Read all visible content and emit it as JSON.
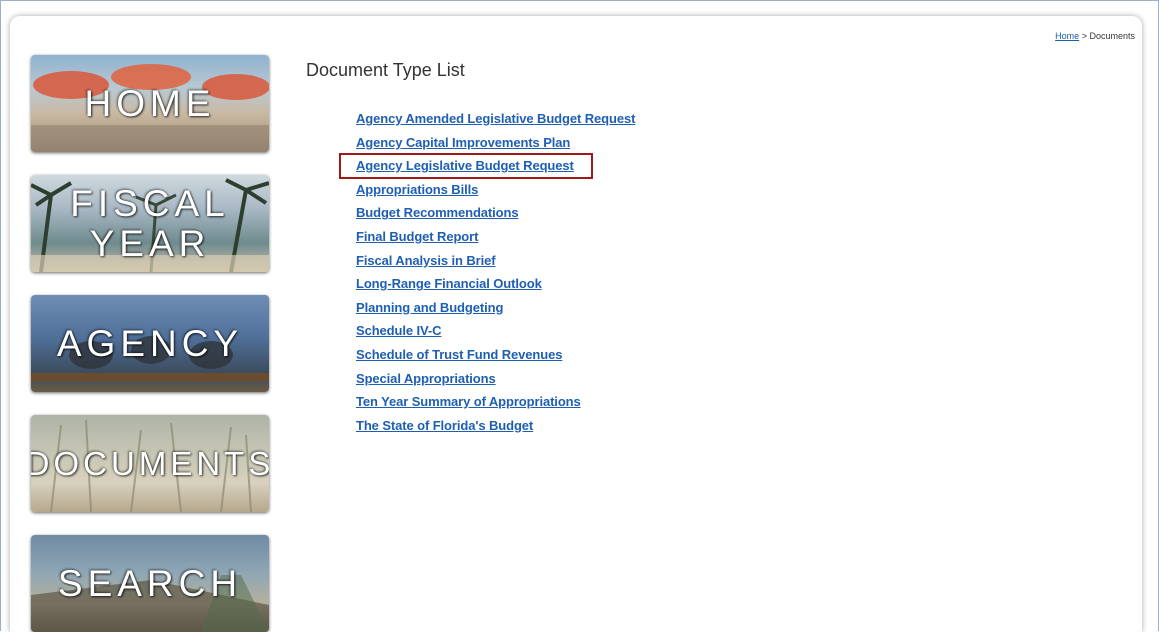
{
  "breadcrumb": {
    "home": "Home",
    "separator": ">",
    "current": "Documents"
  },
  "nav": [
    {
      "label": "HOME"
    },
    {
      "label": "FISCAL YEAR"
    },
    {
      "label": "AGENCY"
    },
    {
      "label": "DOCUMENTS"
    },
    {
      "label": "SEARCH"
    }
  ],
  "main": {
    "title": "Document Type List",
    "documents": [
      "Agency Amended Legislative Budget Request",
      "Agency Capital Improvements Plan",
      "Agency Legislative Budget Request",
      "Appropriations Bills",
      "Budget Recommendations",
      "Final Budget Report",
      "Fiscal Analysis in Brief",
      "Long-Range Financial Outlook",
      "Planning and Budgeting",
      "Schedule IV-C",
      "Schedule of Trust Fund Revenues",
      "Special Appropriations",
      "Ten Year Summary of Appropriations",
      "The State of Florida's Budget"
    ],
    "highlighted_index": 2
  },
  "colors": {
    "link": "#1f5fb3",
    "highlight_border": "#a01818"
  }
}
